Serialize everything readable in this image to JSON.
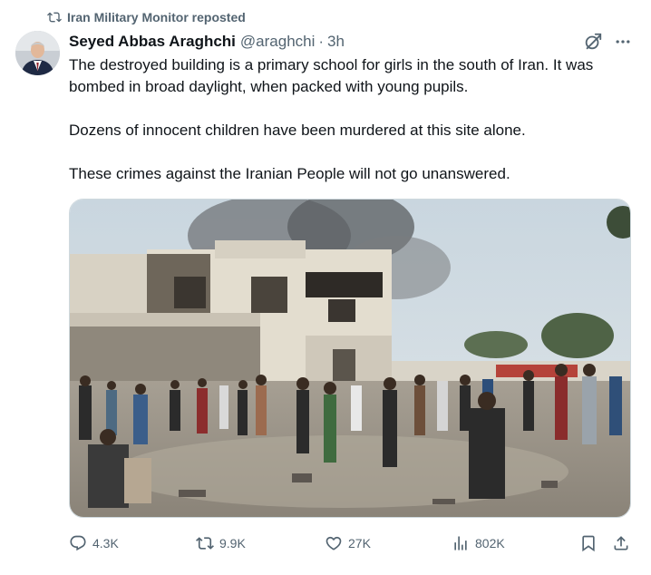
{
  "repost": {
    "label": "Iran Military Monitor reposted",
    "icon": "repost-icon"
  },
  "author": {
    "name": "Seyed Abbas Araghchi",
    "handle": "@araghchi",
    "separator": "·",
    "time": "3h",
    "avatar": "avatar"
  },
  "tweet": {
    "paragraphs": [
      "The destroyed building is a primary school for girls in the south of Iran. It was bombed in broad daylight, when packed with young pupils.",
      "Dozens of innocent children have been murdered at this site alone.",
      "These crimes against the Iranian People will not go unanswered."
    ]
  },
  "icons": {
    "grok": "grok-icon",
    "more": "more-icon"
  },
  "actions": {
    "reply": {
      "count": "4.3K",
      "icon": "reply-icon"
    },
    "repost": {
      "count": "9.9K",
      "icon": "repost-icon"
    },
    "like": {
      "count": "27K",
      "icon": "heart-icon"
    },
    "views": {
      "count": "802K",
      "icon": "views-icon"
    },
    "bookmark": {
      "icon": "bookmark-icon"
    },
    "share": {
      "icon": "share-icon"
    }
  },
  "colors": {
    "text": "#0f1419",
    "secondary": "#536471",
    "border": "#cfd9de"
  }
}
